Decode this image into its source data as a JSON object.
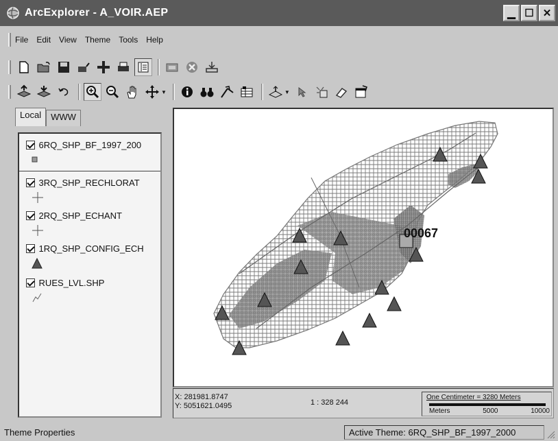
{
  "window": {
    "title": "ArcExplorer - A_VOIR.AEP",
    "app_icon": "globe-icon"
  },
  "menu": [
    "File",
    "Edit",
    "View",
    "Theme",
    "Tools",
    "Help"
  ],
  "toolbar1": {
    "group1": [
      "new-icon",
      "open-icon",
      "save-icon",
      "open-catalog-icon",
      "add-theme-icon",
      "print-icon",
      "toc-toggle-icon"
    ],
    "group2": [
      "database-icon",
      "remove-icon",
      "export-icon"
    ]
  },
  "toolbar2": [
    "layer-up-icon",
    "layer-down-icon",
    "undo-icon",
    "zoom-in-icon",
    "zoom-out-icon",
    "pan-hand-icon",
    "move-icon",
    "identify-icon",
    "find-icon",
    "measure-icon",
    "attribute-table-icon",
    "query-icon",
    "select-icon",
    "select-features-icon",
    "clear-icon",
    "properties-icon"
  ],
  "tabs": [
    {
      "label": "Local",
      "active": true
    },
    {
      "label": "WWW",
      "active": false
    }
  ],
  "layers": [
    {
      "name": "6RQ_SHP_BF_1997_200",
      "symbol": "square",
      "checked": true
    },
    {
      "name": "3RQ_SHP_RECHLORAT",
      "symbol": "cross",
      "checked": true
    },
    {
      "name": "2RQ_SHP_ECHANT",
      "symbol": "cross",
      "checked": true
    },
    {
      "name": "1RQ_SHP_CONFIG_ECH",
      "symbol": "triangle",
      "checked": true
    },
    {
      "name": "RUES_LVL.SHP",
      "symbol": "line",
      "checked": true
    }
  ],
  "map": {
    "label": "00067"
  },
  "coords": {
    "x": "X: 281981.8747",
    "y": "Y: 5051621.0495"
  },
  "scale": "1 : 328 244",
  "scalebar": {
    "label": "One Centimeter = 3280 Meters",
    "ticks": [
      "Meters",
      "5000",
      "10000"
    ]
  },
  "status": {
    "left": "Theme Properties",
    "right": "Active Theme: 6RQ_SHP_BF_1997_2000"
  }
}
